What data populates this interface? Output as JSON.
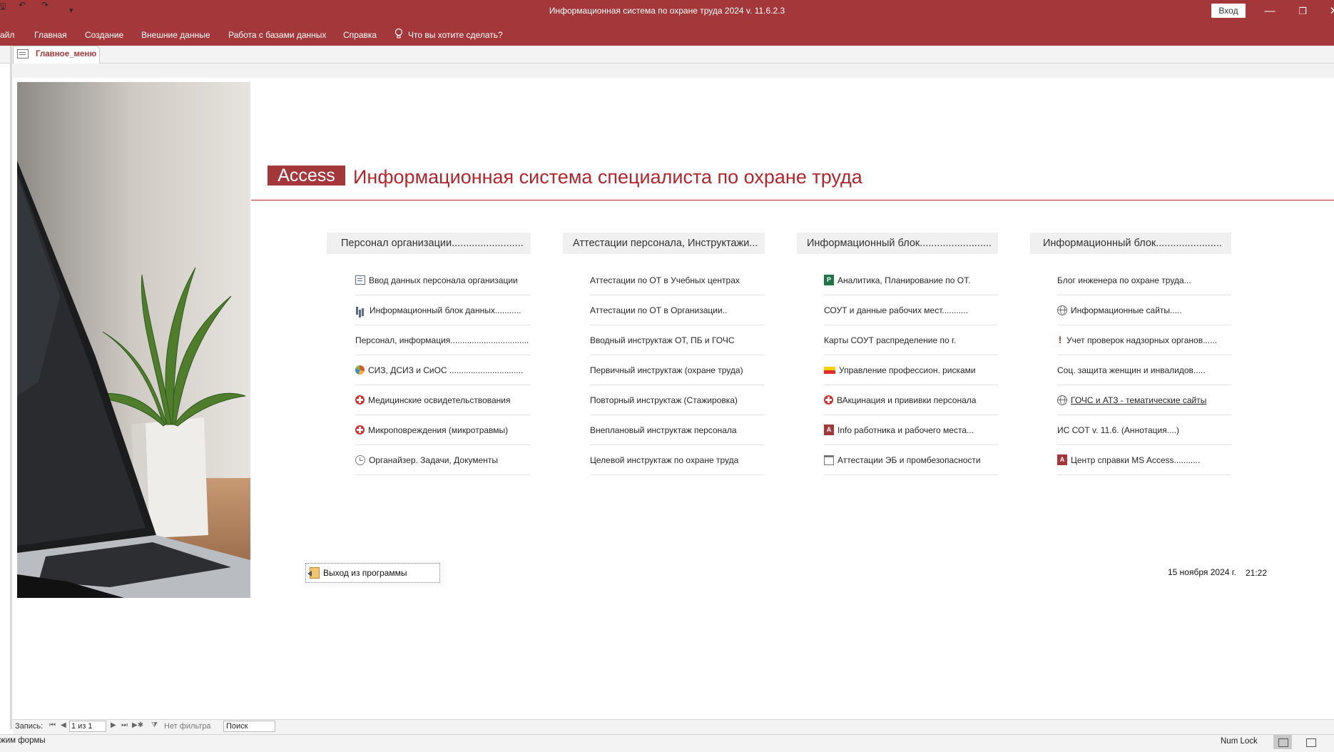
{
  "window": {
    "title": "Информационная система по охране труда 2024 v. 11.6.2.3",
    "sign_in": "Вход",
    "minimize_glyph": "—",
    "restore_glyph": "❐",
    "close_glyph": "✕",
    "save_glyph": "🖫",
    "undo_glyph": "↶",
    "redo_glyph": "↷",
    "customize_glyph": "▾"
  },
  "ribbon": {
    "tabs": [
      "айл",
      "Главная",
      "Создание",
      "Внешние данные",
      "Работа с базами данных",
      "Справка"
    ],
    "tell_me": "Что вы хотите сделать?"
  },
  "document": {
    "tab_label": "Главное_меню"
  },
  "header": {
    "badge": "Access",
    "title": "Информационная система специалиста по охране труда"
  },
  "columns": [
    {
      "header": "Персонал организации.........................",
      "items": [
        {
          "label": "Ввод данных персонала организации",
          "icon": "form-icon"
        },
        {
          "label": "Информационный блок данных...........",
          "icon": "chart-icon"
        },
        {
          "label": "Персонал, информация.................................",
          "icon": ""
        },
        {
          "label": "СИЗ, ДСИЗ и СиОС ...............................",
          "icon": "pie-icon"
        },
        {
          "label": "Медицинские освидетельствования",
          "icon": "medical-icon"
        },
        {
          "label": "Микроповреждения (микротравмы)",
          "icon": "medical-icon"
        },
        {
          "label": "Органайзер. Задачи, Документы",
          "icon": "clock-icon"
        }
      ]
    },
    {
      "header": "Аттестации персонала, Инструктажи...",
      "items": [
        {
          "label": "Аттестации по ОТ  в Учебных центрах",
          "icon": ""
        },
        {
          "label": "Аттестации по ОТ  в Организации..",
          "icon": ""
        },
        {
          "label": "Вводный инструктаж ОТ, ПБ и ГОЧС",
          "icon": ""
        },
        {
          "label": "Первичный инструктаж (охране труда)",
          "icon": ""
        },
        {
          "label": "Повторный инструктаж (Стажировка)",
          "icon": ""
        },
        {
          "label": "Внеплановый инструктаж персонала",
          "icon": ""
        },
        {
          "label": "Целевой инструктаж по охране труда",
          "icon": ""
        }
      ]
    },
    {
      "header": "Информационный блок.........................",
      "items": [
        {
          "label": "Аналитика, Планирование по ОТ.",
          "icon": "project-icon"
        },
        {
          "label": "СОУТ и данные рабочих мест...........",
          "icon": ""
        },
        {
          "label": "Карты СОУТ распределение по г.",
          "icon": ""
        },
        {
          "label": "Управление профессион. рисками",
          "icon": "flag-icon"
        },
        {
          "label": "ВАкцинация и прививки персонала",
          "icon": "medical-icon"
        },
        {
          "label": "Info работника и рабочего места...",
          "icon": "access-icon"
        },
        {
          "label": "Аттестации ЭБ и промбезопасности",
          "icon": "calendar-icon"
        }
      ]
    },
    {
      "header": "Информационный блок.......................",
      "items": [
        {
          "label": "Блог инженера по охране труда...",
          "icon": ""
        },
        {
          "label": "Информационные сайты.....",
          "icon": "globe-icon"
        },
        {
          "label": "Учет проверок надзорных органов......",
          "icon": "exclamation-icon"
        },
        {
          "label": "Соц. защита женщин и инвалидов.....",
          "icon": ""
        },
        {
          "label": "ГОЧС и АТЗ - тематические сайты",
          "icon": "globe-icon",
          "link": true
        },
        {
          "label": "ИС СОТ v. 11.6.  (Аннотация....)",
          "icon": ""
        },
        {
          "label": "Центр справки MS Access...........",
          "icon": "access-icon"
        }
      ]
    }
  ],
  "footer": {
    "exit_label": "Выход из программы",
    "date": "15 ноября 2024 г.",
    "time": "21:22"
  },
  "record_nav": {
    "label": "Запись:",
    "position": "1 из 1",
    "filter": "Нет фильтра",
    "search": "Поиск"
  },
  "status": {
    "left": "жим формы",
    "num_lock": "Num Lock"
  },
  "colors": {
    "accent": "#a4373a",
    "title_red": "#b3262c"
  }
}
